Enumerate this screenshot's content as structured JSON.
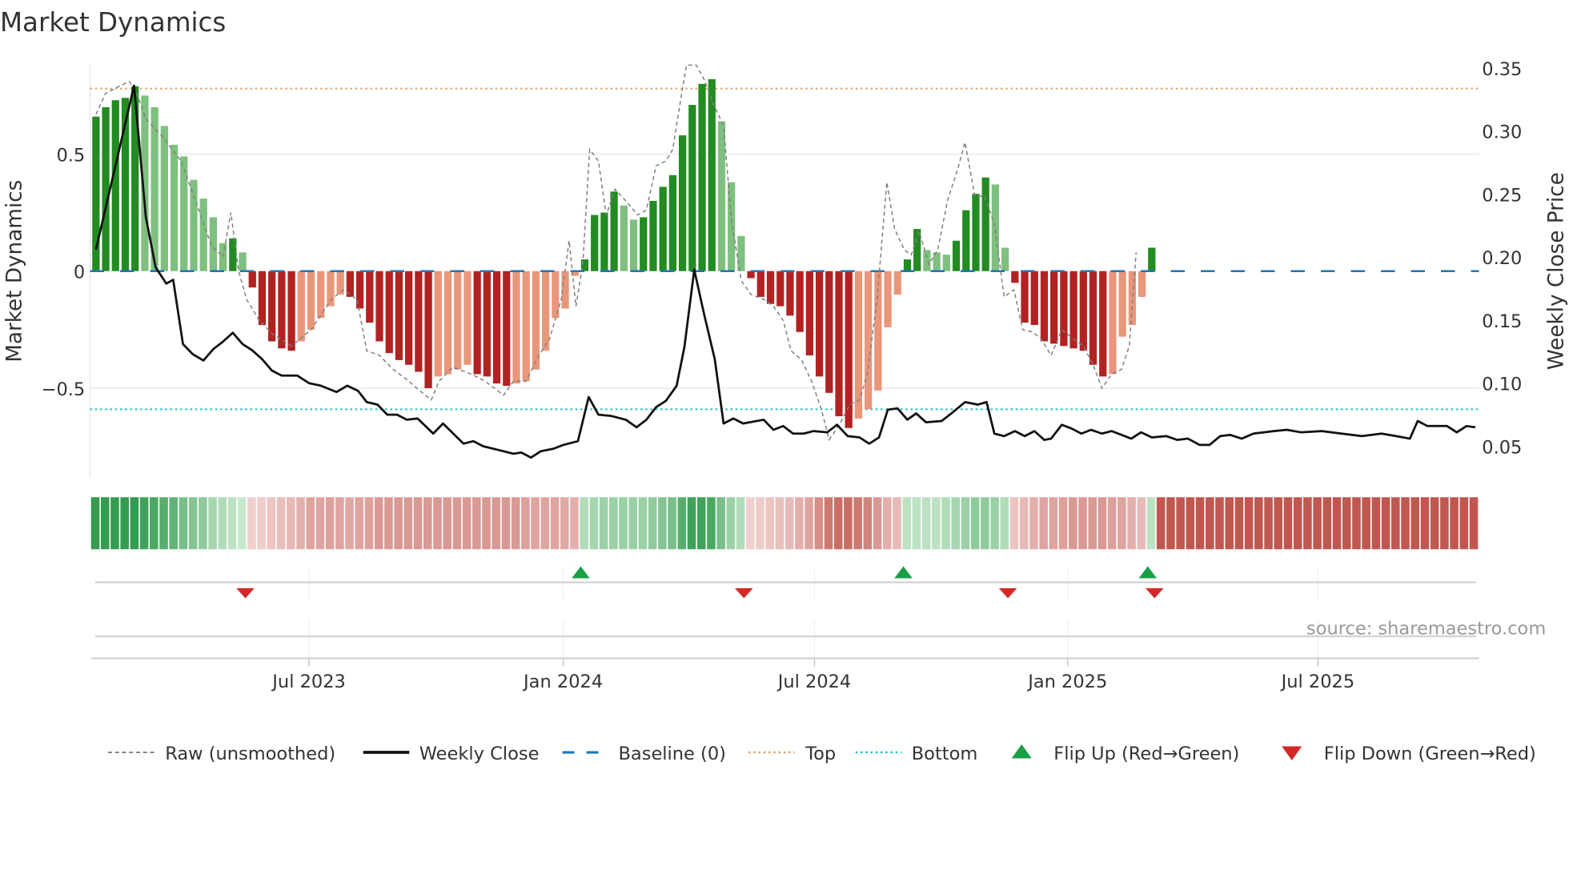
{
  "chart_data": {
    "type": "bar+line",
    "title": "Market Dynamics",
    "ylabel_left": "Market Dynamics",
    "ylabel_right": "Weekly Close Price",
    "left_ticks": [
      {
        "v": 0.5,
        "label": "0.5"
      },
      {
        "v": 0,
        "label": "0"
      },
      {
        "v": -0.5,
        "label": "−0.5"
      }
    ],
    "right_ticks": [
      {
        "v": 0.35,
        "label": "0.35"
      },
      {
        "v": 0.3,
        "label": "0.30"
      },
      {
        "v": 0.25,
        "label": "0.25"
      },
      {
        "v": 0.2,
        "label": "0.20"
      },
      {
        "v": 0.15,
        "label": "0.15"
      },
      {
        "v": 0.1,
        "label": "0.10"
      },
      {
        "v": 0.05,
        "label": "0.05"
      }
    ],
    "x_ticks": [
      {
        "week": 21.8,
        "label": "Jul 2023"
      },
      {
        "week": 47.8,
        "label": "Jan 2024"
      },
      {
        "week": 73.5,
        "label": "Jul 2024"
      },
      {
        "week": 99.4,
        "label": "Jan 2025"
      },
      {
        "week": 125,
        "label": "Jul 2025"
      }
    ],
    "weeks_total": 142,
    "top_level": 0.78,
    "bottom_level": -0.59,
    "baseline": 0,
    "bars": [
      0.66,
      0.7,
      0.73,
      0.74,
      0.79,
      0.75,
      0.7,
      0.62,
      0.54,
      0.49,
      0.39,
      0.31,
      0.23,
      0.12,
      0.14,
      0.08,
      -0.07,
      -0.23,
      -0.3,
      -0.33,
      -0.34,
      -0.3,
      -0.25,
      -0.2,
      -0.15,
      -0.1,
      -0.11,
      -0.16,
      -0.22,
      -0.3,
      -0.35,
      -0.38,
      -0.4,
      -0.43,
      -0.5,
      -0.45,
      -0.44,
      -0.42,
      -0.4,
      -0.44,
      -0.45,
      -0.48,
      -0.49,
      -0.48,
      -0.47,
      -0.42,
      -0.34,
      -0.2,
      -0.16,
      -0.02,
      0.05,
      0.24,
      0.25,
      0.34,
      0.28,
      0.22,
      0.23,
      0.3,
      0.36,
      0.41,
      0.58,
      0.71,
      0.8,
      0.82,
      0.64,
      0.38,
      0.15,
      -0.03,
      -0.11,
      -0.14,
      -0.15,
      -0.19,
      -0.26,
      -0.36,
      -0.45,
      -0.52,
      -0.62,
      -0.67,
      -0.63,
      -0.59,
      -0.51,
      -0.24,
      -0.1,
      0.05,
      0.18,
      0.09,
      0.08,
      0.07,
      0.13,
      0.26,
      0.33,
      0.4,
      0.37,
      0.1,
      -0.05,
      -0.22,
      -0.23,
      -0.3,
      -0.31,
      -0.32,
      -0.33,
      -0.34,
      -0.4,
      -0.45,
      -0.44,
      -0.28,
      -0.23,
      -0.11,
      0.1
    ],
    "raw": [
      [
        0,
        0.67
      ],
      [
        1.0,
        0.76
      ],
      [
        2.4,
        0.79
      ],
      [
        3.4,
        0.81
      ],
      [
        4.1,
        0.77
      ],
      [
        5.1,
        0.65
      ],
      [
        6.7,
        0.58
      ],
      [
        8.7,
        0.47
      ],
      [
        10.2,
        0.3
      ],
      [
        11.8,
        0.11
      ],
      [
        13.0,
        0.06
      ],
      [
        13.8,
        0.25
      ],
      [
        14.6,
        0.0
      ],
      [
        15.4,
        -0.12
      ],
      [
        16.7,
        -0.21
      ],
      [
        18.1,
        -0.27
      ],
      [
        20.0,
        -0.32
      ],
      [
        22.0,
        -0.25
      ],
      [
        24.1,
        -0.12
      ],
      [
        25.3,
        -0.08
      ],
      [
        26.7,
        -0.12
      ],
      [
        27.7,
        -0.34
      ],
      [
        29.0,
        -0.36
      ],
      [
        30.4,
        -0.42
      ],
      [
        31.7,
        -0.46
      ],
      [
        33.1,
        -0.51
      ],
      [
        34.3,
        -0.55
      ],
      [
        35.1,
        -0.47
      ],
      [
        36.5,
        -0.41
      ],
      [
        38.4,
        -0.44
      ],
      [
        39.8,
        -0.47
      ],
      [
        41.7,
        -0.53
      ],
      [
        42.7,
        -0.47
      ],
      [
        44.0,
        -0.47
      ],
      [
        45.3,
        -0.36
      ],
      [
        46.4,
        -0.29
      ],
      [
        47.6,
        -0.12
      ],
      [
        48.4,
        0.13
      ],
      [
        49.1,
        -0.15
      ],
      [
        49.8,
        0.03
      ],
      [
        50.5,
        0.52
      ],
      [
        51.4,
        0.47
      ],
      [
        52.2,
        0.24
      ],
      [
        53.1,
        0.35
      ],
      [
        54.2,
        0.3
      ],
      [
        55.4,
        0.24
      ],
      [
        56.3,
        0.26
      ],
      [
        57.3,
        0.45
      ],
      [
        58.3,
        0.47
      ],
      [
        59.0,
        0.52
      ],
      [
        59.8,
        0.73
      ],
      [
        60.4,
        0.88
      ],
      [
        61.4,
        0.88
      ],
      [
        62.2,
        0.82
      ],
      [
        63.2,
        0.71
      ],
      [
        64.2,
        0.62
      ],
      [
        65.0,
        0.22
      ],
      [
        66.0,
        -0.04
      ],
      [
        67.0,
        -0.1
      ],
      [
        68.3,
        -0.12
      ],
      [
        69.3,
        -0.15
      ],
      [
        70.3,
        -0.21
      ],
      [
        71.1,
        -0.34
      ],
      [
        72.2,
        -0.38
      ],
      [
        73.2,
        -0.47
      ],
      [
        74.2,
        -0.59
      ],
      [
        75.0,
        -0.72
      ],
      [
        76.0,
        -0.66
      ],
      [
        77.1,
        -0.57
      ],
      [
        78.1,
        -0.55
      ],
      [
        78.9,
        -0.44
      ],
      [
        79.9,
        -0.12
      ],
      [
        80.9,
        0.38
      ],
      [
        81.7,
        0.18
      ],
      [
        82.7,
        0.09
      ],
      [
        83.4,
        0.07
      ],
      [
        84.2,
        0.17
      ],
      [
        85.2,
        0.03
      ],
      [
        86.1,
        0.09
      ],
      [
        87.1,
        0.3
      ],
      [
        88.1,
        0.43
      ],
      [
        88.9,
        0.55
      ],
      [
        89.9,
        0.32
      ],
      [
        90.9,
        0.32
      ],
      [
        91.9,
        0.2
      ],
      [
        92.9,
        -0.11
      ],
      [
        93.9,
        -0.08
      ],
      [
        94.8,
        -0.25
      ],
      [
        95.8,
        -0.26
      ],
      [
        96.7,
        -0.29
      ],
      [
        97.7,
        -0.36
      ],
      [
        98.8,
        -0.25
      ],
      [
        100.0,
        -0.29
      ],
      [
        101.0,
        -0.32
      ],
      [
        102.0,
        -0.4
      ],
      [
        102.9,
        -0.5
      ],
      [
        103.9,
        -0.44
      ],
      [
        104.9,
        -0.42
      ],
      [
        105.7,
        -0.32
      ],
      [
        106.4,
        0.08
      ]
    ],
    "close": [
      [
        0,
        0.206
      ],
      [
        3.9,
        0.336
      ],
      [
        5.1,
        0.232
      ],
      [
        6.1,
        0.192
      ],
      [
        7.2,
        0.179
      ],
      [
        7.9,
        0.182
      ],
      [
        8.9,
        0.131
      ],
      [
        9.9,
        0.123
      ],
      [
        11,
        0.118
      ],
      [
        12,
        0.127
      ],
      [
        13,
        0.133
      ],
      [
        14,
        0.14
      ],
      [
        15,
        0.131
      ],
      [
        16,
        0.126
      ],
      [
        17,
        0.119
      ],
      [
        18,
        0.11
      ],
      [
        19,
        0.106
      ],
      [
        20.6,
        0.106
      ],
      [
        21.8,
        0.1
      ],
      [
        23,
        0.098
      ],
      [
        24.6,
        0.093
      ],
      [
        25.7,
        0.098
      ],
      [
        26.8,
        0.094
      ],
      [
        27.7,
        0.085
      ],
      [
        28.8,
        0.083
      ],
      [
        29.8,
        0.075
      ],
      [
        30.8,
        0.075
      ],
      [
        31.8,
        0.071
      ],
      [
        32.9,
        0.072
      ],
      [
        34.5,
        0.06
      ],
      [
        35.5,
        0.068
      ],
      [
        37.6,
        0.052
      ],
      [
        38.6,
        0.054
      ],
      [
        39.6,
        0.05
      ],
      [
        41.7,
        0.046
      ],
      [
        42.7,
        0.044
      ],
      [
        43.5,
        0.045
      ],
      [
        44.5,
        0.041
      ],
      [
        45.5,
        0.046
      ],
      [
        46.8,
        0.048
      ],
      [
        47.8,
        0.051
      ],
      [
        49.3,
        0.054
      ],
      [
        50.4,
        0.089
      ],
      [
        51.4,
        0.075
      ],
      [
        52.7,
        0.074
      ],
      [
        54.2,
        0.071
      ],
      [
        55.3,
        0.065
      ],
      [
        56.3,
        0.071
      ],
      [
        57.3,
        0.081
      ],
      [
        58.3,
        0.086
      ],
      [
        59.4,
        0.098
      ],
      [
        60.2,
        0.129
      ],
      [
        61.2,
        0.19
      ],
      [
        62.2,
        0.155
      ],
      [
        63.3,
        0.119
      ],
      [
        64.2,
        0.068
      ],
      [
        65.2,
        0.072
      ],
      [
        66.2,
        0.068
      ],
      [
        68.3,
        0.071
      ],
      [
        69.3,
        0.063
      ],
      [
        70.3,
        0.066
      ],
      [
        71.3,
        0.06
      ],
      [
        72.4,
        0.06
      ],
      [
        73.4,
        0.062
      ],
      [
        74.8,
        0.061
      ],
      [
        75.8,
        0.067
      ],
      [
        76.9,
        0.058
      ],
      [
        78.1,
        0.057
      ],
      [
        79.1,
        0.052
      ],
      [
        80.1,
        0.057
      ],
      [
        81,
        0.079
      ],
      [
        82,
        0.08
      ],
      [
        83,
        0.071
      ],
      [
        83.9,
        0.076
      ],
      [
        84.9,
        0.069
      ],
      [
        86.5,
        0.07
      ],
      [
        87.5,
        0.076
      ],
      [
        88.9,
        0.085
      ],
      [
        90.2,
        0.083
      ],
      [
        91.1,
        0.085
      ],
      [
        91.9,
        0.06
      ],
      [
        92.9,
        0.058
      ],
      [
        94,
        0.062
      ],
      [
        95,
        0.058
      ],
      [
        96,
        0.062
      ],
      [
        97,
        0.055
      ],
      [
        97.7,
        0.056
      ],
      [
        98.8,
        0.067
      ],
      [
        99.8,
        0.064
      ],
      [
        100.8,
        0.06
      ],
      [
        101.8,
        0.063
      ],
      [
        102.9,
        0.06
      ],
      [
        103.9,
        0.062
      ],
      [
        104.9,
        0.059
      ],
      [
        105.9,
        0.056
      ],
      [
        106.9,
        0.061
      ],
      [
        108,
        0.057
      ],
      [
        109.5,
        0.058
      ],
      [
        110.6,
        0.055
      ],
      [
        111.7,
        0.056
      ],
      [
        112.9,
        0.051
      ],
      [
        113.9,
        0.051
      ],
      [
        115,
        0.058
      ],
      [
        116,
        0.059
      ],
      [
        117.2,
        0.056
      ],
      [
        118.4,
        0.06
      ],
      [
        120.5,
        0.062
      ],
      [
        121.8,
        0.063
      ],
      [
        123.3,
        0.061
      ],
      [
        125.4,
        0.062
      ],
      [
        127.4,
        0.06
      ],
      [
        129.5,
        0.058
      ],
      [
        131.5,
        0.06
      ],
      [
        133,
        0.058
      ],
      [
        134.4,
        0.056
      ],
      [
        135.2,
        0.07
      ],
      [
        136.2,
        0.066
      ],
      [
        138.2,
        0.066
      ],
      [
        139.2,
        0.061
      ],
      [
        140.2,
        0.066
      ],
      [
        141.1,
        0.065
      ]
    ],
    "heat_strip": [
      0.9,
      0.9,
      0.9,
      0.9,
      0.9,
      0.85,
      0.8,
      0.75,
      0.7,
      0.6,
      0.55,
      0.5,
      0.4,
      0.35,
      0.3,
      0.25,
      -0.2,
      -0.22,
      -0.25,
      -0.28,
      -0.3,
      -0.35,
      -0.4,
      -0.4,
      -0.42,
      -0.4,
      -0.38,
      -0.4,
      -0.42,
      -0.45,
      -0.45,
      -0.45,
      -0.45,
      -0.45,
      -0.45,
      -0.45,
      -0.45,
      -0.45,
      -0.45,
      -0.45,
      -0.45,
      -0.45,
      -0.45,
      -0.45,
      -0.42,
      -0.4,
      -0.4,
      -0.4,
      -0.38,
      -0.35,
      0.35,
      0.4,
      0.45,
      0.45,
      0.45,
      0.45,
      0.45,
      0.5,
      0.55,
      0.6,
      0.75,
      0.85,
      0.85,
      0.8,
      0.6,
      0.45,
      0.35,
      -0.2,
      -0.22,
      -0.25,
      -0.28,
      -0.3,
      -0.35,
      -0.4,
      -0.5,
      -0.6,
      -0.65,
      -0.65,
      -0.6,
      -0.55,
      -0.45,
      -0.35,
      -0.3,
      0.3,
      0.3,
      0.3,
      0.3,
      0.35,
      0.4,
      0.45,
      0.5,
      0.5,
      0.45,
      0.35,
      -0.25,
      -0.3,
      -0.35,
      -0.4,
      -0.4,
      -0.42,
      -0.45,
      -0.45,
      -0.45,
      -0.45,
      -0.42,
      -0.4,
      -0.35,
      -0.3,
      0.3,
      -0.75,
      -0.75,
      -0.75,
      -0.75,
      -0.75,
      -0.75,
      -0.75,
      -0.75,
      -0.75,
      -0.75,
      -0.75,
      -0.75,
      -0.75,
      -0.75,
      -0.75,
      -0.75,
      -0.75,
      -0.75,
      -0.75,
      -0.75,
      -0.75,
      -0.75,
      -0.75,
      -0.75,
      -0.75,
      -0.75,
      -0.75,
      -0.75,
      -0.75,
      -0.75,
      -0.75,
      -0.75,
      -0.75
    ],
    "flip_up_weeks": [
      50,
      83,
      108
    ],
    "flip_down_weeks": [
      16,
      67,
      94,
      109
    ],
    "colors": {
      "green_dark": "#228b22",
      "green_light": "#7fbf7f",
      "red_dark": "#b22222",
      "red_light": "#e9967a",
      "raw": "#808080",
      "close": "#111111",
      "baseline": "#1f77b4",
      "top": "#e6a064",
      "bottom": "#17becf",
      "flip_up": "#1a9e46",
      "flip_down": "#d62728"
    },
    "legend": [
      {
        "key": "raw",
        "label": "Raw (unsmoothed)"
      },
      {
        "key": "close",
        "label": "Weekly Close"
      },
      {
        "key": "baseline",
        "label": "Baseline (0)"
      },
      {
        "key": "top",
        "label": "Top"
      },
      {
        "key": "bottom",
        "label": "Bottom"
      },
      {
        "key": "flip_up",
        "label": "Flip Up (Red→Green)"
      },
      {
        "key": "flip_down",
        "label": "Flip Down (Green→Red)"
      }
    ],
    "legend_placement": "bottom",
    "source": "source: sharemaestro.com"
  }
}
